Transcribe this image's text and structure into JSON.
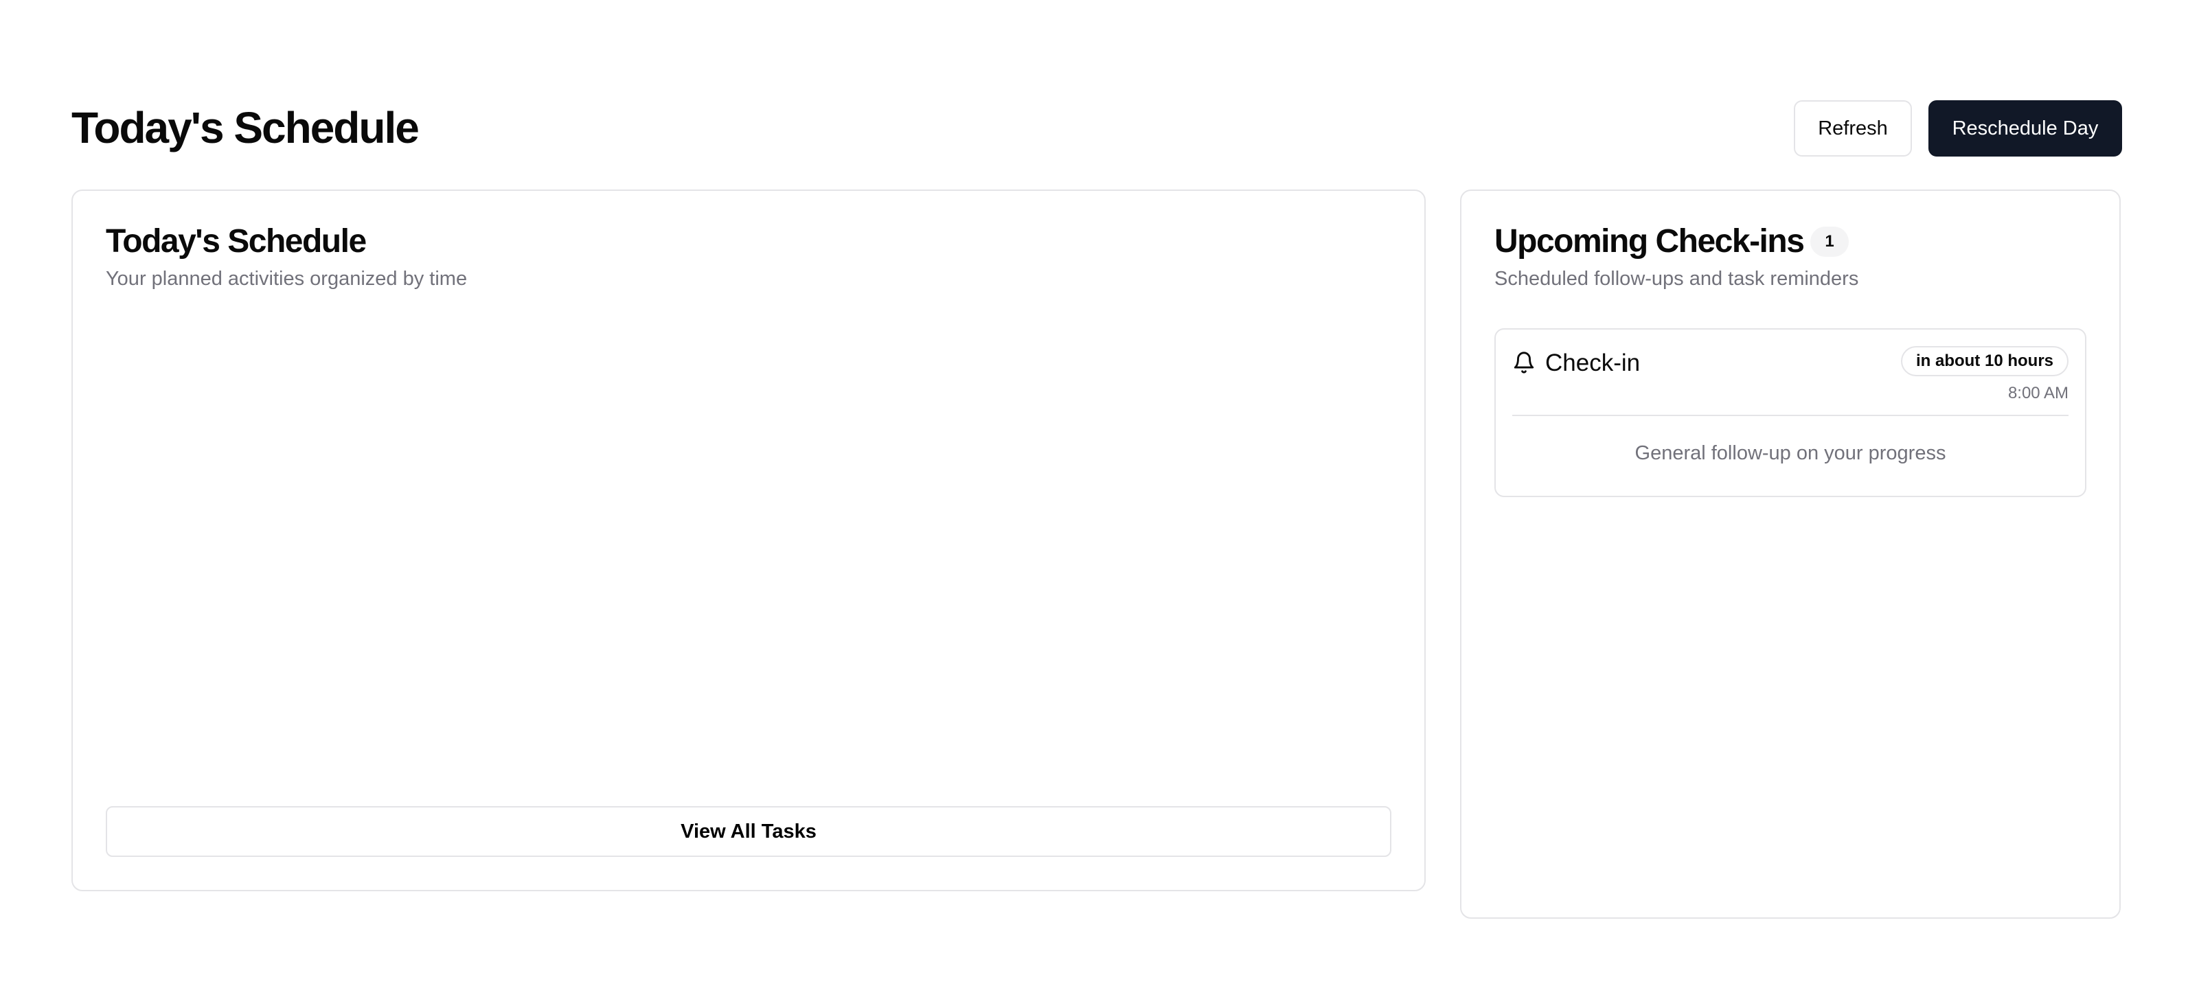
{
  "header": {
    "title": "Today's Schedule",
    "refresh_label": "Refresh",
    "reschedule_label": "Reschedule Day"
  },
  "schedule_card": {
    "title": "Today's Schedule",
    "description": "Your planned activities organized by time",
    "view_all_label": "View All Tasks"
  },
  "checkins_card": {
    "title": "Upcoming Check-ins",
    "count": "1",
    "description": "Scheduled follow-ups and task reminders",
    "items": [
      {
        "icon": "bell-icon",
        "title": "Check-in",
        "relative_time": "in about 10 hours",
        "time": "8:00 AM",
        "note": "General follow-up on your progress"
      }
    ]
  },
  "colors": {
    "primary_button": "#111827",
    "border": "#e4e4e7",
    "muted_text": "#71717a"
  }
}
